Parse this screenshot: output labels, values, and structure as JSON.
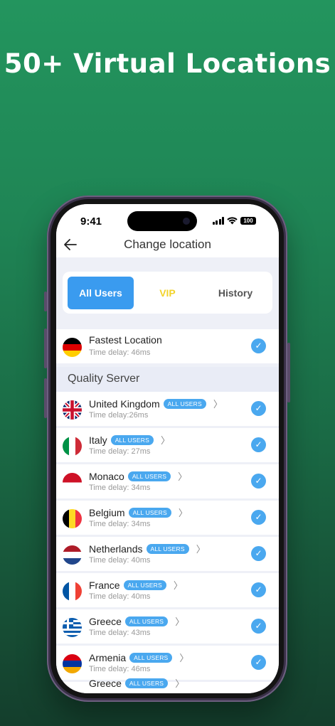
{
  "headline": "50+ Virtual Locations",
  "status": {
    "time": "9:41",
    "battery": "100"
  },
  "header": {
    "title": "Change location"
  },
  "tabs": [
    {
      "label": "All Users"
    },
    {
      "label": "VIP"
    },
    {
      "label": "History"
    }
  ],
  "fastest": {
    "name": "Fastest Location",
    "delay": "Time delay: 46ms",
    "flag": "germany"
  },
  "section": {
    "label": "Quality Server"
  },
  "badge_label": "ALL USERS",
  "servers": [
    {
      "name": "United Kingdom",
      "delay": "Time delay:26ms",
      "flag": "uk"
    },
    {
      "name": "Italy",
      "delay": "Time delay: 27ms",
      "flag": "italy"
    },
    {
      "name": "Monaco",
      "delay": "Time delay: 34ms",
      "flag": "monaco"
    },
    {
      "name": "Belgium",
      "delay": "Time delay: 34ms",
      "flag": "belgium"
    },
    {
      "name": "Netherlands",
      "delay": "Time delay: 40ms",
      "flag": "netherlands"
    },
    {
      "name": "France",
      "delay": "Time delay: 40ms",
      "flag": "france"
    },
    {
      "name": "Greece",
      "delay": "Time delay: 43ms",
      "flag": "greece"
    },
    {
      "name": "Armenia",
      "delay": "Time delay: 46ms",
      "flag": "armenia"
    },
    {
      "name": "Greece",
      "delay": "",
      "flag": "greece"
    }
  ],
  "colors": {
    "accent": "#3a9bef",
    "vip": "#f2d32b",
    "background": "#1f8555"
  }
}
